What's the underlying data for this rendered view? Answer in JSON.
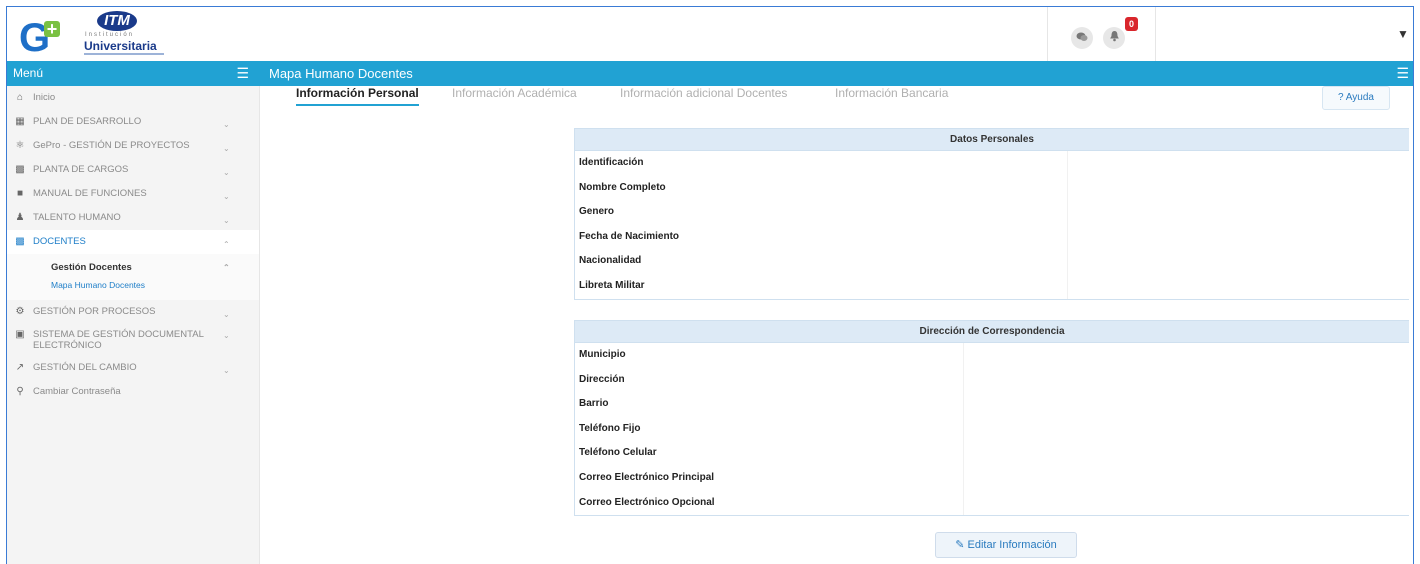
{
  "header": {
    "brand_letter": "G",
    "brand_plus": "+",
    "itm_mark": "ITM",
    "itm_institution": "Institución",
    "itm_university": "Universitaria",
    "badge_count": "0"
  },
  "sidebar": {
    "title": "Menú",
    "items": [
      {
        "label": "Inicio"
      },
      {
        "label": "PLAN DE DESARROLLO"
      },
      {
        "label": "GePro - GESTIÓN DE PROYECTOS"
      },
      {
        "label": "PLANTA DE CARGOS"
      },
      {
        "label": "MANUAL DE FUNCIONES"
      },
      {
        "label": "TALENTO HUMANO"
      },
      {
        "label": "DOCENTES"
      },
      {
        "label": "GESTIÓN POR PROCESOS"
      },
      {
        "label": "SISTEMA DE GESTIÓN DOCUMENTAL ELECTRÓNICO"
      },
      {
        "label": "GESTIÓN DEL CAMBIO"
      },
      {
        "label": "Cambiar Contraseña"
      }
    ],
    "submenu": {
      "group": "Gestión Docentes",
      "link": "Mapa Humano Docentes"
    }
  },
  "main": {
    "title": "Mapa Humano Docentes",
    "tabs": [
      {
        "label": "Información Personal"
      },
      {
        "label": "Información Académica"
      },
      {
        "label": "Información adicional Docentes"
      },
      {
        "label": "Información Bancaria"
      }
    ],
    "help_label": "? Ayuda",
    "personal": {
      "title": "Datos Personales",
      "fields": [
        "Identificación",
        "Nombre Completo",
        "Genero",
        "Fecha de Nacimiento",
        "Nacionalidad",
        "Libreta Militar"
      ]
    },
    "address": {
      "title": "Dirección de Correspondencia",
      "fields": [
        "Municipio",
        "Dirección",
        "Barrio",
        "Teléfono Fijo",
        "Teléfono Celular",
        "Correo Electrónico Principal",
        "Correo Electrónico Opcional"
      ]
    },
    "edit_label": "Editar Información"
  },
  "colors": {
    "accent": "#21a2d3",
    "link": "#1e7ec8",
    "badge": "#d9262c"
  }
}
